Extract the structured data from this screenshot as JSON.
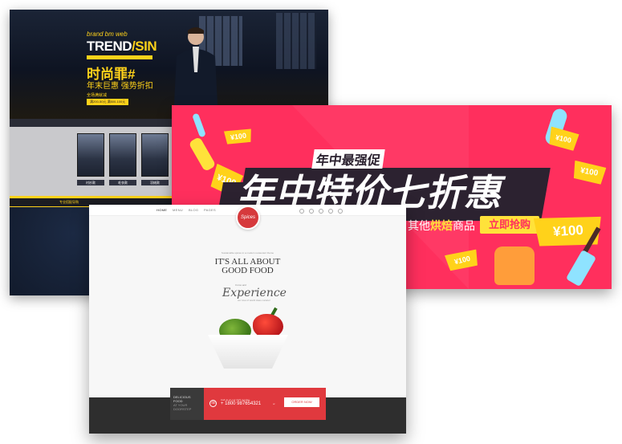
{
  "fashion": {
    "brand_small": "brand bm web",
    "brand_main": "TREND",
    "brand_suffix": "/SIN",
    "title_cn": "时尚罪#",
    "subtitle_cn": "年末巨惠 强势折扣",
    "small_cn": "全场满就减",
    "pill_text": "满200-50元 满500-100元",
    "products": [
      "衬衫款",
      "毛衣款",
      "羽绒款",
      ""
    ],
    "ybar_text": "专业搭配导购"
  },
  "sale": {
    "subtitle": "年中最强促",
    "headline": "年中特价七折惠",
    "line2_prefix": "其他",
    "line2_highlight": "烘焙",
    "line2_suffix": "商品",
    "buy_button": "立即抢购",
    "coupons": [
      "¥100",
      "¥100",
      "¥100",
      "¥100",
      "¥100",
      "¥100"
    ],
    "colors": {
      "bg": "#ff2f5d",
      "accent": "#ffe23a",
      "dark": "#2c2230"
    }
  },
  "food": {
    "nav": [
      "HOME",
      "MENU",
      "BLOG",
      "PAGES"
    ],
    "logo_text": "Spices",
    "eyebrow": "Sustainable spices in a modern restaurant theme",
    "title_line1": "IT'S ALL ABOUT",
    "title_line2": "GOOD FOOD",
    "script_small": "Come and",
    "script": "Experience",
    "script_caption": "our love of world class cuisine!",
    "box_line1": "DELICIOUS",
    "box_line2": "FOOD",
    "box_line3": "AT YOUR",
    "box_line4": "DOORSTEP",
    "phone_pre": "Call us on our 24/7 number",
    "phone": "+ 1800 987654321",
    "or_text": "or",
    "order_button": "ORDER NOW",
    "colors": {
      "red": "#e0393e",
      "dark": "#2e2e2e"
    }
  }
}
